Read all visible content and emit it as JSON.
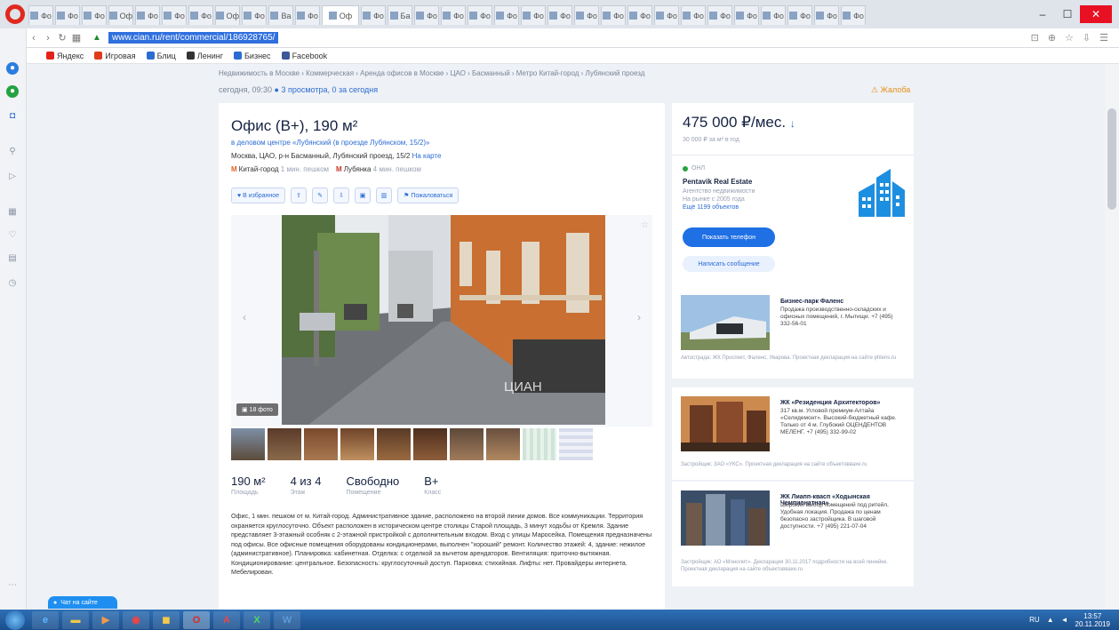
{
  "browser": {
    "url": "www.cian.ru/rent/commercial/186928765/",
    "tabs": [
      "Фо",
      "Фо",
      "Фо",
      "Оф",
      "Фо",
      "Фо",
      "Фо",
      "Оф",
      "Фо",
      "Ва",
      "Фо",
      "Оф",
      "Фо",
      "Ба",
      "Фо",
      "Фо",
      "Фо",
      "Фо",
      "Фо",
      "Фо",
      "Фо",
      "Фо",
      "Фо",
      "Фо",
      "Фо",
      "Фо",
      "Фо",
      "Фо",
      "Фо",
      "Фо",
      "Фо"
    ],
    "active_tab": "Оф",
    "bookmarks": [
      {
        "label": "Яндекс",
        "color": "#e2231a"
      },
      {
        "label": "Игровая",
        "color": "#e23b1a"
      },
      {
        "label": "Блиц",
        "color": "#2b6cd3"
      },
      {
        "label": "Ленинг",
        "color": "#333333"
      },
      {
        "label": "Бизнес",
        "color": "#2b6cd3"
      },
      {
        "label": "Facebook",
        "color": "#3b5998"
      }
    ]
  },
  "page": {
    "breadcrumbs": "Недвижимость в Москве › Коммерческая › Аренда офисов в Москве › ЦАО › Басманный › Метро Китай-город › Лубянский проезд",
    "updated": "сегодня, 09:30",
    "views": "3 просмотра, 0 за сегодня",
    "complain": "Жалоба",
    "title": "Офис (B+), 190 м²",
    "bc_link": "в деловом центре «Лубянский (в проезде Лубянском, 15/2)»",
    "address": "Москва, ЦАО, р-н Басманный, Лубянский проезд, 15/2",
    "address_map": "На карте",
    "metro": [
      {
        "name": "Китай-город",
        "time": "1 мин. пешком"
      },
      {
        "name": "Лубянка",
        "time": "4 мин. пешком"
      }
    ],
    "actions": {
      "favorite": "В избранное",
      "download": "Пожаловаться"
    },
    "photo_count": "18 фото",
    "watermark": "ЦИАН",
    "facts": [
      {
        "value": "190 м²",
        "label": "Площадь"
      },
      {
        "value": "4 из 4",
        "label": "Этаж"
      },
      {
        "value": "Свободно",
        "label": "Помещение"
      },
      {
        "value": "B+",
        "label": "Класс"
      }
    ],
    "description": "Офис, 1 мин. пешком от м. Китай-город. Административное здание, расположено на второй линии домов. Все коммуникации. Территория охраняется круглосуточно. Объект расположен в историческом центре столицы Старой площадь, 3 минут ходьбы от Кремля. Здание представляет 3-этажный особняк с 2-этажной пристройкой с дополнительным входом. Вход с улицы Маросейка. Помещения предназначены под офисы. Все офисные помещения оборудованы кондиционерами, выполнен \"хороший\" ремонт. Количество этажей: 4, здание: нежилое (административное). Планировка: кабинетная. Отделка: с отделкой за вычетом арендаторов. Вентиляция: приточно-вытяжная. Кондиционирование: центральное. Безопасность: круглосуточный доступ. Парковка: стихийная. Лифты: нет. Провайдеры интернета. Мебелирован.",
    "price": "475 000 ₽/мес.",
    "price_sub": "30 000 ₽ за м² в год",
    "agent": {
      "status": "ОНЛ",
      "name": "Pentavik Real Estate",
      "line1": "Агентство недвижимости",
      "line2": "На рынке с 2005 года",
      "line3": "Ещё 1199 объектов",
      "phone_btn": "Показать телефон",
      "msg_btn": "Написать сообщение"
    },
    "ads": [
      {
        "title": "Бизнес-парк Фаленс",
        "body": "Продажа производственно-складских и офисных помещений, г. Мытищи. +7 (495) 332-56-01",
        "foot": "Автострада: ЖК Проспект, Фаленс, Уварова. Проектная декларация на сайте phlens.ru"
      },
      {
        "title": "ЖК «Резиденция Архитекторов»",
        "body": "317 кв.м. Угловой премиум-Алтайа «Селидемонт». Высокий-бюджетный кафе. Только от 4 м. Глубокий ОЦЕНДЕНТОВ МЕЛЕНГ. +7 (495) 332-99-02",
        "foot": "Застройщик: ЗАО «УКС». Проектная декларация на сайте объектоввахе.ru"
      },
      {
        "title": "ЖК Лиапп-квасп «Ходынская Чемпионатная»",
        "body": "Широкий выбор помещений под ритейл. Удобная локация. Продажа по ценам безопасно застройщика. В шаговой доступности. +7 (495) 221-07-04",
        "foot": "Застройщик: АО «Монолит». Декларация 30.11.2017 подробности на всей линейке. Проектная декларация на сайте объектоввахе.ru"
      }
    ],
    "chat": "Чат на сайте"
  },
  "taskbar": {
    "time": "13:57",
    "date": "20.11.2019",
    "lang": "RU"
  }
}
